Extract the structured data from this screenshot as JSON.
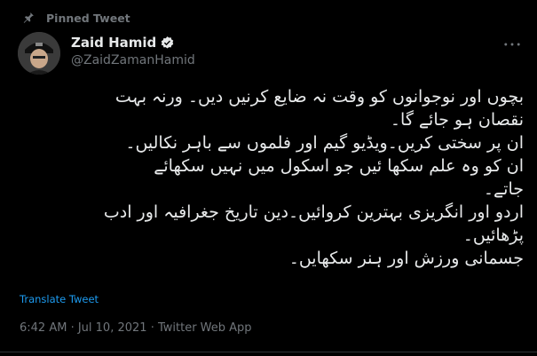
{
  "pinned": {
    "label": "Pinned Tweet"
  },
  "author": {
    "name": "Zaid Hamid",
    "handle": "@ZaidZamanHamid",
    "verified": true
  },
  "tweet": {
    "lines": [
      "بچوں اور نوجوانوں کو وقت نہ ضایع کرنیں دیں۔ ورنہ بہت",
      "نقصان ہو جائے گا۔",
      "ان پر سختی کریں۔ویڈیو گیم اور فلموں سے باہر نکالیں۔",
      "ان کو وہ علم سکھا ئیں جو اسکول میں نہیں سکھائے",
      "جاتے۔",
      "اردو اور انگریزی بہترین کروائیں۔دین تاریخ جغرافیہ اور ادب",
      "پڑھائیں۔",
      "جسمانی ورزش اور ہنر سکھایں۔"
    ]
  },
  "translate_label": "Translate Tweet",
  "meta": {
    "time": "6:42 AM",
    "separator": " · ",
    "date": "Jul 10, 2021",
    "source": "Twitter Web App"
  },
  "colors": {
    "background": "#000000",
    "text": "#e7e9ea",
    "muted": "#71767b",
    "accent": "#1d9bf0"
  }
}
